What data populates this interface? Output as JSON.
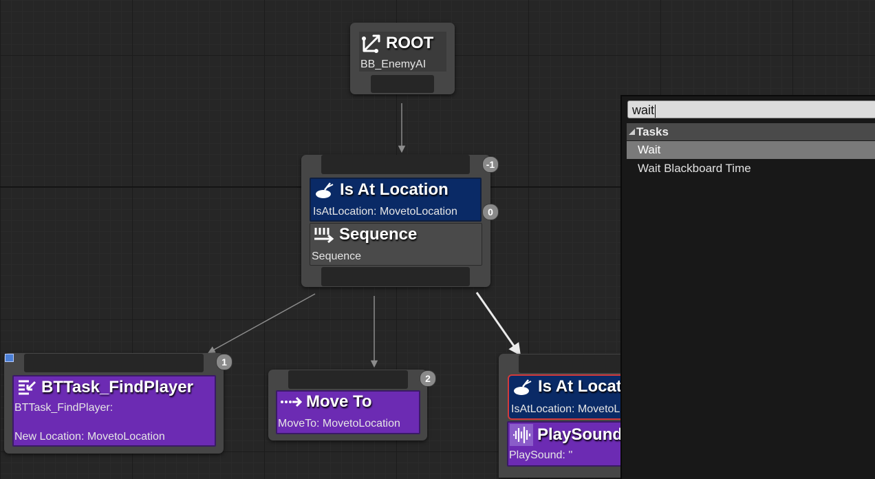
{
  "root_node": {
    "title": "ROOT",
    "subtitle": "BB_EnemyAI",
    "icon": "root-branch-icon"
  },
  "sequence_node": {
    "index": "-1",
    "decorator": {
      "title": "Is At Location",
      "subtitle": "IsAtLocation: MovetoLocation",
      "index": "0",
      "icon": "is-at-location-icon"
    },
    "composite": {
      "title": "Sequence",
      "subtitle": "Sequence",
      "icon": "sequence-icon"
    }
  },
  "find_player_node": {
    "index": "1",
    "title": "BTTask_FindPlayer",
    "subtitle": "BTTask_FindPlayer:",
    "detail": "New Location: MovetoLocation",
    "icon": "blueprint-task-icon"
  },
  "move_to_node": {
    "index": "2",
    "title": "Move To",
    "subtitle": "MoveTo: MovetoLocation",
    "icon": "move-to-icon"
  },
  "right_node": {
    "decorator": {
      "title": "Is At Location",
      "subtitle": "IsAtLocation: MovetoLocation",
      "icon": "is-at-location-icon"
    },
    "task": {
      "title": "PlaySound",
      "subtitle": "PlaySound: ''",
      "icon": "sound-wave-icon"
    }
  },
  "search_panel": {
    "query": "wait",
    "category": "Tasks",
    "items": [
      {
        "label": "Wait",
        "selected": true
      },
      {
        "label": "Wait Blackboard Time",
        "selected": false
      }
    ]
  },
  "colors": {
    "graph_background": "#262626",
    "decorator": "#0a2a66",
    "task": "#6c2bb3",
    "node_body": "#464646",
    "highlight": "#d43a3a"
  }
}
